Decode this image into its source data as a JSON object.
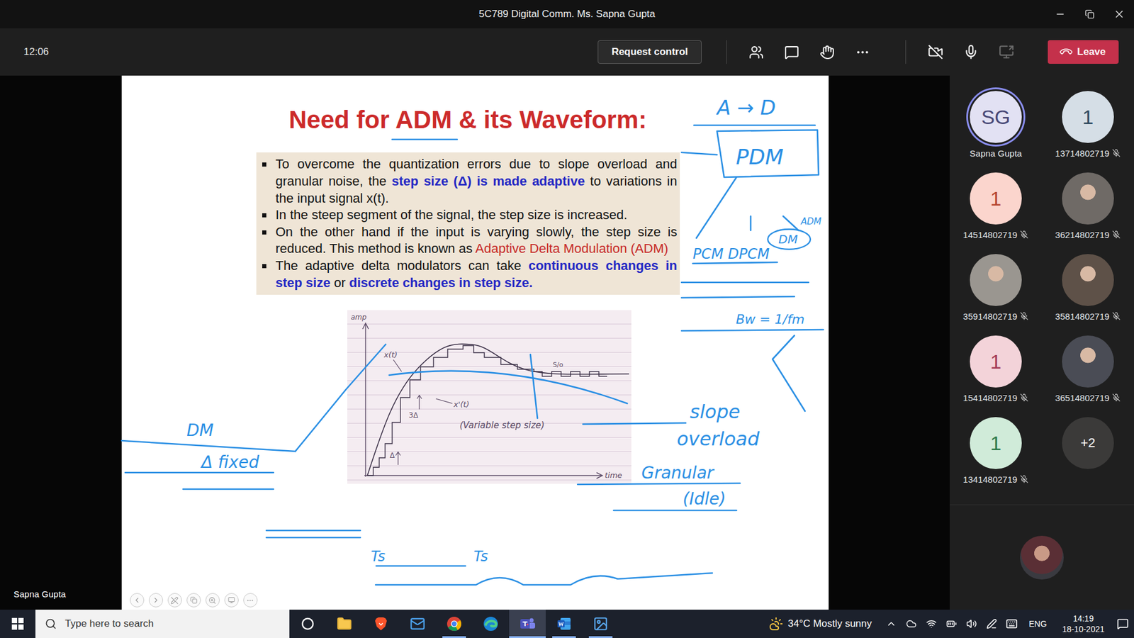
{
  "window": {
    "title": "5C789 Digital Comm. Ms. Sapna Gupta"
  },
  "meeting_bar": {
    "elapsed": "12:06",
    "request_control": "Request control",
    "leave": "Leave",
    "camera_on": false,
    "mic_muted": false,
    "share_enabled": false
  },
  "stage": {
    "presenter": "Sapna Gupta"
  },
  "slide": {
    "title": "Need for ADM & its Waveform:",
    "bullets": [
      [
        {
          "text": "To overcome the quantization errors due to slope overload and granular noise, the ",
          "kind": "plain"
        },
        {
          "text": "step size (Δ) is made adaptive",
          "kind": "blue"
        },
        {
          "text": " to variations in the input signal x(t).",
          "kind": "plain"
        }
      ],
      [
        {
          "text": "In the steep segment of the signal, the step size is increased.",
          "kind": "plain"
        }
      ],
      [
        {
          "text": "On the other hand if the input is varying slowly, the step size is reduced. This method is known as ",
          "kind": "plain"
        },
        {
          "text": "Adaptive Delta Modulation (ADM)",
          "kind": "red"
        }
      ],
      [
        {
          "text": "The adaptive delta modulators can take ",
          "kind": "plain"
        },
        {
          "text": "continuous changes in step size",
          "kind": "blue"
        },
        {
          "text": " or ",
          "kind": "plain"
        },
        {
          "text": "discrete changes in step size.",
          "kind": "blue"
        }
      ]
    ],
    "figure": {
      "amp": "amp",
      "time": "time",
      "x": "x(t)",
      "x_hat": "x'(t)",
      "step_big": "3Δ",
      "step_small": "Δ",
      "caption": "(Variable step size)",
      "granular": "S/o"
    },
    "ink": {
      "a_to_d": "A → D",
      "pdm": "PDM",
      "dm": "DM",
      "adm": "ADM",
      "pcm": "PCM DPCM",
      "bandwidth": "Bw = 1/fm",
      "slope": "slope",
      "overload": "overload",
      "granular": "Granular",
      "idle": "(Idle)",
      "dm_left": "DM",
      "delta_fixed": "Δ fixed",
      "ts_1": "Ts",
      "ts_2": "Ts"
    }
  },
  "participants": [
    {
      "name": "Sapna Gupta",
      "initials": "SG",
      "kind": "initials",
      "muted": false,
      "presenting": true,
      "color": "#e2e1f3",
      "text_color": "#464775"
    },
    {
      "name": "13714802719",
      "initials": "1",
      "kind": "initials",
      "muted": true,
      "presenting": false,
      "color": "#d5dee6",
      "text_color": "#2f4a5e"
    },
    {
      "name": "14514802719",
      "initials": "1",
      "kind": "initials",
      "muted": true,
      "presenting": false,
      "color": "#fbd5cd",
      "text_color": "#b5452f"
    },
    {
      "name": "36214802719",
      "kind": "photo",
      "muted": true,
      "presenting": false,
      "color": "#6f6a66"
    },
    {
      "name": "35914802719",
      "kind": "photo",
      "muted": true,
      "presenting": false,
      "color": "#9a9690"
    },
    {
      "name": "35814802719",
      "kind": "photo",
      "muted": true,
      "presenting": false,
      "color": "#5e5148"
    },
    {
      "name": "15414802719",
      "initials": "1",
      "kind": "initials",
      "muted": true,
      "presenting": false,
      "color": "#f3d3d9",
      "text_color": "#a33b55"
    },
    {
      "name": "36514802719",
      "kind": "photo",
      "muted": true,
      "presenting": false,
      "color": "#4a4c55"
    },
    {
      "name": "13414802719",
      "initials": "1",
      "kind": "initials",
      "muted": true,
      "presenting": false,
      "color": "#d0ebd9",
      "text_color": "#2d7a4a"
    }
  ],
  "overflow": "+2",
  "taskbar": {
    "search_placeholder": "Type here to search",
    "apps": [
      {
        "kind": "cortana",
        "selected": false,
        "running": false
      },
      {
        "kind": "files",
        "selected": false,
        "running": false
      },
      {
        "kind": "brave",
        "selected": false,
        "running": false
      },
      {
        "kind": "mail",
        "selected": false,
        "running": false
      },
      {
        "kind": "chrome",
        "selected": false,
        "running": true
      },
      {
        "kind": "edge",
        "selected": false,
        "running": false
      },
      {
        "kind": "teams",
        "selected": true,
        "running": true
      },
      {
        "kind": "word",
        "selected": false,
        "running": true
      },
      {
        "kind": "photos",
        "selected": false,
        "running": true
      }
    ],
    "weather": "34°C Mostly sunny",
    "language": "ENG",
    "time": "14:19",
    "date": "18-10-2021"
  }
}
